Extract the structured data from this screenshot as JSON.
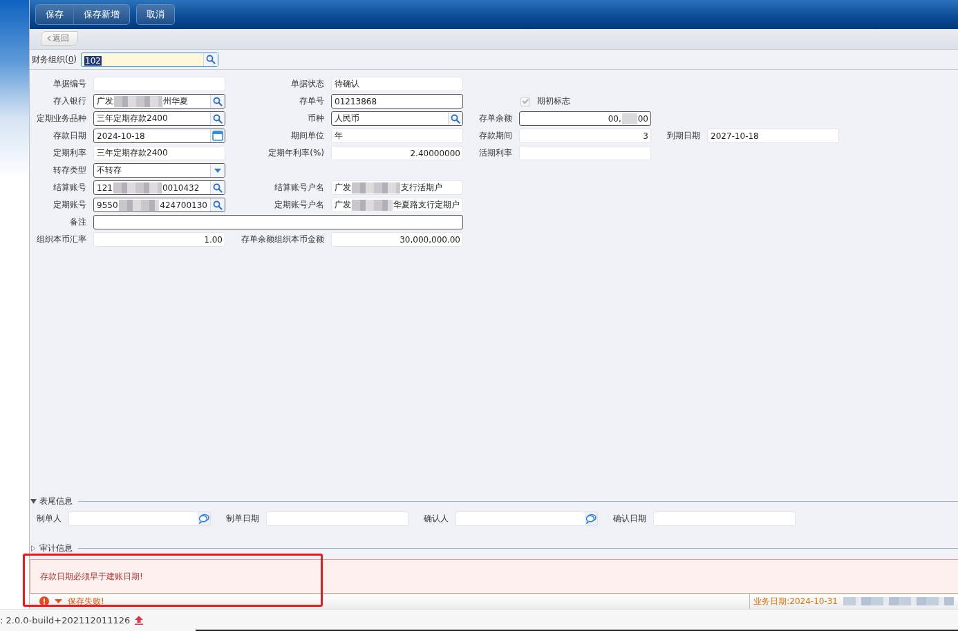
{
  "toolbar": {
    "button_groups": [
      [
        {
          "label": "保存"
        },
        {
          "label": "保存新增"
        }
      ],
      [
        {
          "label": "取消"
        }
      ]
    ]
  },
  "back_button": {
    "label": "返回"
  },
  "org_field": {
    "label_parts": [
      "财务组织(",
      "0",
      ")"
    ],
    "value": "102"
  },
  "form": {
    "rows": [
      {
        "cells": [
          {
            "label": "单据编号",
            "kind": "plain"
          },
          {
            "label": "单据状态",
            "kind": "plain",
            "value": "待确认"
          }
        ]
      },
      {
        "cells": [
          {
            "label": "存入银行",
            "kind": "lookup",
            "value_parts": [
              "广发",
              "州华夏"
            ]
          },
          {
            "label": "存单号",
            "kind": "text",
            "value": "01213868"
          },
          {
            "kind": "checkbox",
            "label": "期初标志",
            "checked": true,
            "disabled": true
          }
        ]
      },
      {
        "cells": [
          {
            "label": "定期业务品种",
            "kind": "lookup",
            "value": "三年定期存款2400"
          },
          {
            "label": "币种",
            "kind": "lookup",
            "value": "人民币"
          },
          {
            "label": "存单余额",
            "kind": "number",
            "bordered": true,
            "value_parts": [
              "00,",
              "00"
            ]
          }
        ]
      },
      {
        "cells": [
          {
            "label": "存款日期",
            "kind": "date",
            "value": "2024-10-18"
          },
          {
            "label": "期间单位",
            "kind": "plain",
            "value": "年"
          },
          {
            "label": "存款期间",
            "kind": "number",
            "value": "3"
          },
          {
            "label": "到期日期",
            "kind": "plain",
            "value": "2027-10-18"
          }
        ]
      },
      {
        "cells": [
          {
            "label": "定期利率",
            "kind": "plain",
            "value": "三年定期存款2400"
          },
          {
            "label": "定期年利率(%)",
            "kind": "number",
            "value": "2.40000000"
          },
          {
            "label": "活期利率",
            "kind": "plain"
          }
        ]
      },
      {
        "cells": [
          {
            "label": "转存类型",
            "kind": "select",
            "value": "不转存"
          }
        ]
      },
      {
        "cells": [
          {
            "label": "结算账号",
            "kind": "lookup",
            "value_parts": [
              "121",
              "0010432"
            ]
          },
          {
            "label": "结算账号户名",
            "kind": "plain",
            "value_parts": [
              "广发",
              "支行活期户"
            ]
          }
        ]
      },
      {
        "cells": [
          {
            "label": "定期账号",
            "kind": "lookup",
            "value_parts": [
              "9550",
              "424700130"
            ]
          },
          {
            "label": "定期账号户名",
            "kind": "plain",
            "value_parts": [
              "广发",
              "华夏路支行定期户"
            ]
          }
        ]
      },
      {
        "cells": [
          {
            "label": "备注",
            "kind": "wide"
          }
        ]
      },
      {
        "cells": [
          {
            "label": "组织本币汇率",
            "kind": "number",
            "value": "1.00"
          },
          {
            "label": "存单余额组织本币金额",
            "kind": "number",
            "value": "30,000,000.00"
          }
        ]
      }
    ]
  },
  "sections": [
    {
      "title": "表尾信息",
      "expanded": true,
      "fields": [
        {
          "label": "制单人",
          "kind": "person"
        },
        {
          "label": "制单日期",
          "kind": "plain"
        },
        {
          "label": "确认人",
          "kind": "person"
        },
        {
          "label": "确认日期",
          "kind": "plain"
        }
      ]
    },
    {
      "title": "审计信息",
      "expanded": false
    }
  ],
  "error_panel": {
    "message": "存款日期必须早于建账日期!"
  },
  "status_bar": {
    "message": "保存失败!",
    "business_date": "业务日期:2024-10-31"
  },
  "footer": {
    "version": ": 2.0.0-build+202112011126"
  }
}
